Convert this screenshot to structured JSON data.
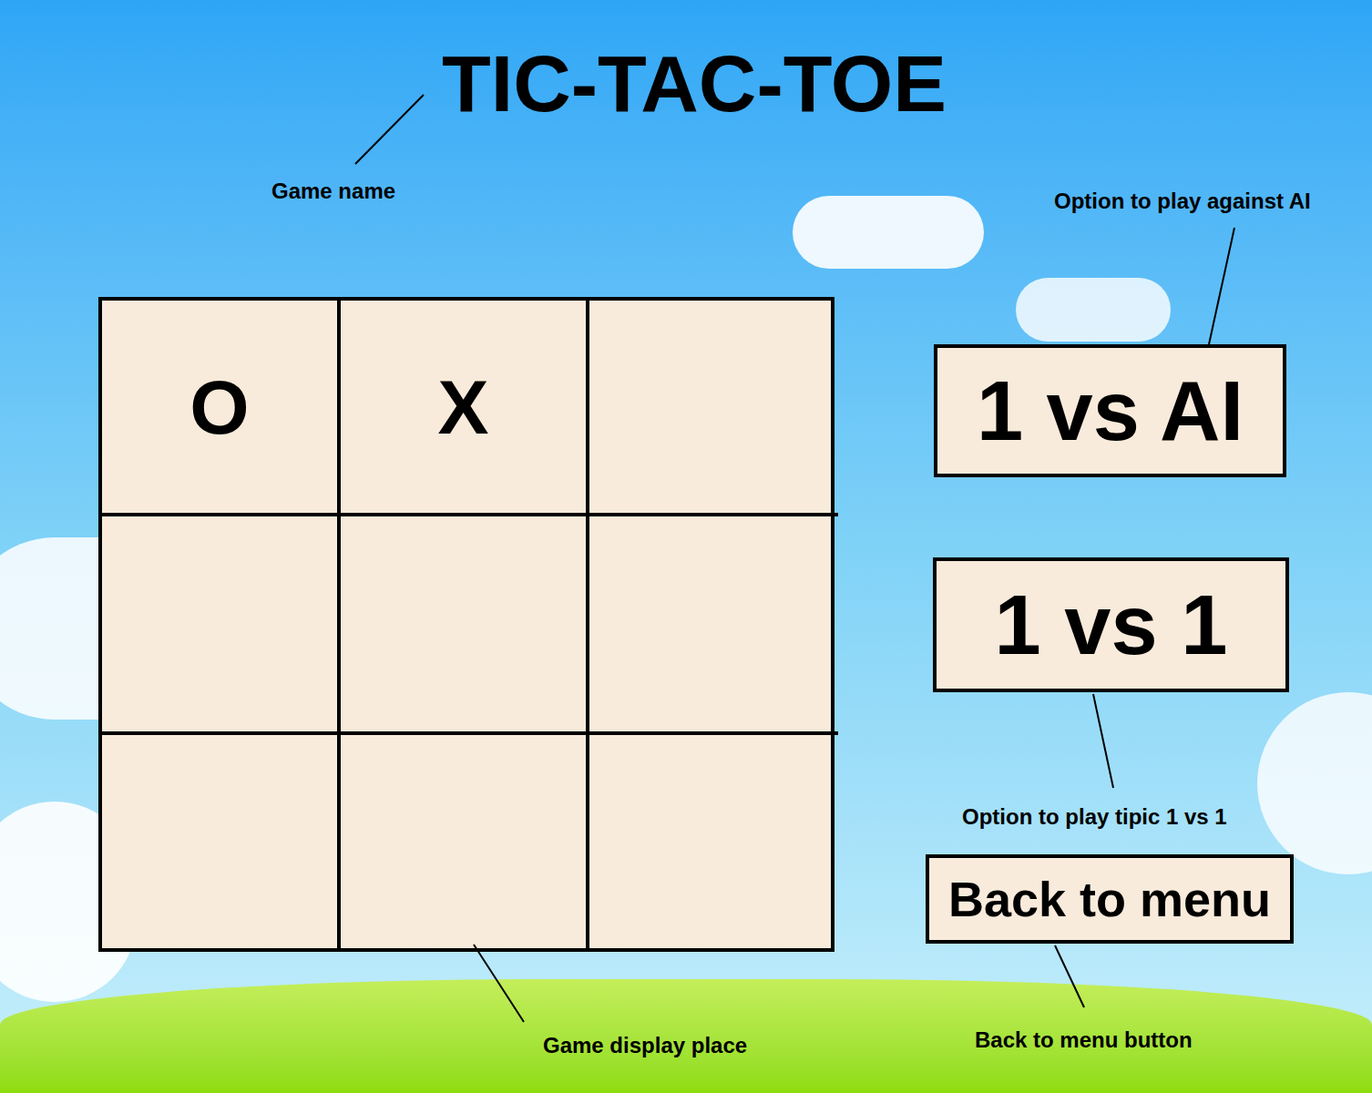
{
  "title": "TIC-TAC-TOE",
  "board": {
    "cells": [
      {
        "mark": "O"
      },
      {
        "mark": "X"
      },
      {
        "mark": ""
      },
      {
        "mark": ""
      },
      {
        "mark": ""
      },
      {
        "mark": ""
      },
      {
        "mark": ""
      },
      {
        "mark": ""
      },
      {
        "mark": ""
      }
    ]
  },
  "buttons": [
    {
      "label": "1 vs AI"
    },
    {
      "label": "1 vs 1"
    },
    {
      "label": "Back to menu"
    }
  ],
  "annotations": [
    {
      "text": "Game name"
    },
    {
      "text": "Option to play against AI"
    },
    {
      "text": "Option to play tipic 1 vs 1"
    },
    {
      "text": "Game display place"
    },
    {
      "text": "Back to menu button"
    }
  ]
}
